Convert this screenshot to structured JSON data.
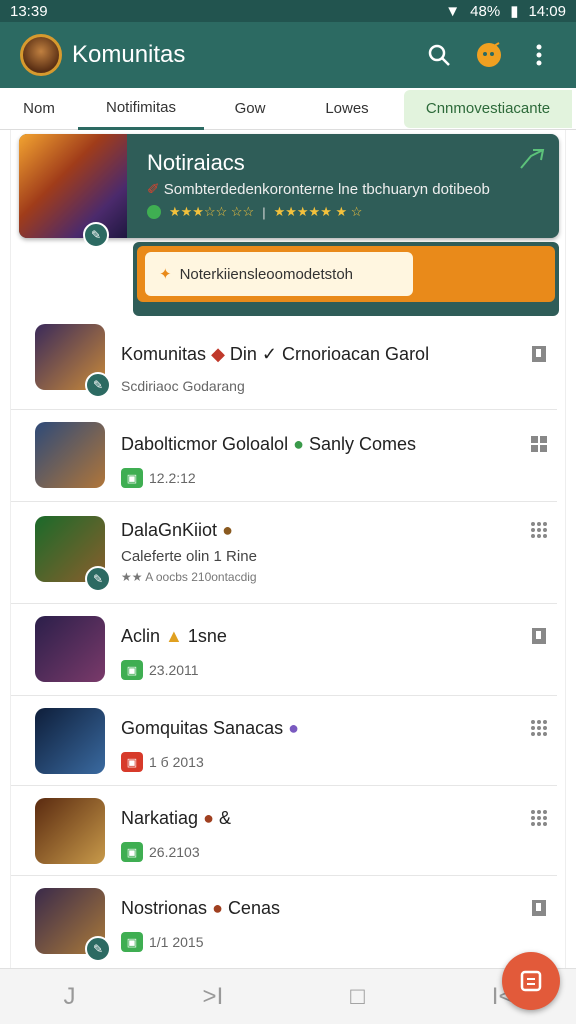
{
  "status_bar": {
    "time": "13:39",
    "battery": "48%",
    "extra": "14:09"
  },
  "app": {
    "title": "Komunitas"
  },
  "tabs": [
    {
      "label": "Nom"
    },
    {
      "label": "Notifimitas"
    },
    {
      "label": "Gow"
    },
    {
      "label": "Lowes"
    },
    {
      "label": "Cnnmovestiacante"
    }
  ],
  "featured": {
    "title": "Notiraiacs",
    "description": "Sombterdedenkoronterne lne tbchuaryn dotibeob",
    "rating_left": "★★★☆☆ ☆☆",
    "rating_right": "★★★★★ ★ ☆"
  },
  "notification": {
    "text": "Noterkiiensleoomodetstoh"
  },
  "items": [
    {
      "title": "Komunitas",
      "title_extra": "Din ✓  Crnorioacan  Garol",
      "sub": "Scdiriaoc  Godarang",
      "thumb": "#3a2a5a,#c98a3a"
    },
    {
      "title": "Dabolticmor Goloalol",
      "title_extra": "Sanly  Comes",
      "sub": "12.2:12",
      "chip": "green",
      "thumb": "#2e4a78,#b0763a"
    },
    {
      "title": "DalaGnKiiot",
      "title_extra": "",
      "sub": "Caleferte olin 1 Rine",
      "sub2": "★★ A oocbs 210ontacdig",
      "thumb": "#1a6a2a,#8b5e2c"
    },
    {
      "title": "Aclin",
      "title_extra": "1sne",
      "sub": "23.2011",
      "chip": "green",
      "thumb": "#2b1f4a,#7a3a6a"
    },
    {
      "title": "Gomquitas Sanacas",
      "title_extra": "",
      "sub": "1 б 2013",
      "chip": "red",
      "thumb": "#0e1e3a,#3a6aa0"
    },
    {
      "title": "Narkatiag",
      "title_extra": "&",
      "sub": "26.2103",
      "chip": "green",
      "thumb": "#5a2a10,#c89a4a"
    },
    {
      "title": "Nostrionas",
      "title_extra": "Cenas",
      "sub": "1/1 2015",
      "chip": "green",
      "thumb": "#3a2a4a,#aa7a3a"
    }
  ],
  "navbar": {
    "items": [
      "J",
      ">I",
      "□",
      "I<"
    ]
  }
}
